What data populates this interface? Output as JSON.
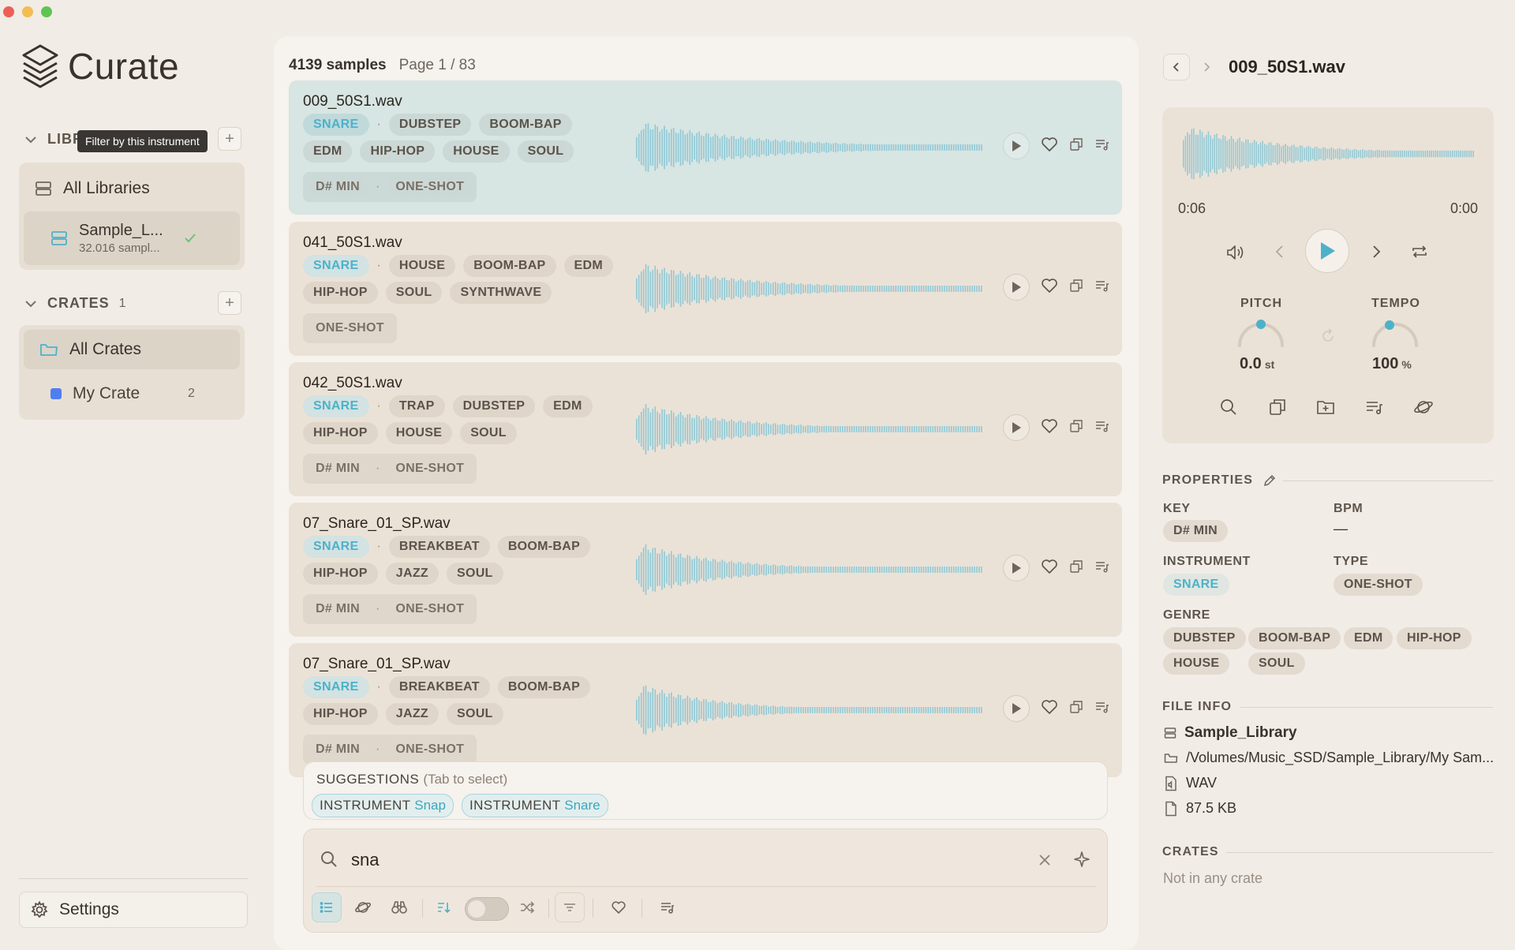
{
  "app": {
    "name": "Curate"
  },
  "tooltip": "Filter by this instrument",
  "sidebar": {
    "libraries_header": "LIBR",
    "libraries": [
      {
        "label": "All Libraries"
      },
      {
        "label": "Sample_L...",
        "sub": "32.016 sampl..."
      }
    ],
    "crates_header": "CRATES",
    "crates_count": "1",
    "crates": [
      {
        "label": "All Crates"
      },
      {
        "label": "My Crate",
        "count": "2",
        "color": "#4f7ef0"
      }
    ],
    "settings_label": "Settings"
  },
  "list": {
    "count": "4139 samples",
    "page": "Page 1 / 83",
    "items": [
      {
        "name": "009_50S1.wav",
        "instrument": "SNARE",
        "row1": [
          "DUBSTEP",
          "BOOM-BAP"
        ],
        "row2": [
          "EDM",
          "HIP-HOP",
          "HOUSE",
          "SOUL"
        ],
        "key": "D# MIN",
        "type": "ONE-SHOT"
      },
      {
        "name": "041_50S1.wav",
        "instrument": "SNARE",
        "row1": [
          "HOUSE",
          "BOOM-BAP",
          "EDM"
        ],
        "row2": [
          "HIP-HOP",
          "SOUL",
          "SYNTHWAVE"
        ],
        "key": "",
        "type": "ONE-SHOT"
      },
      {
        "name": "042_50S1.wav",
        "instrument": "SNARE",
        "row1": [
          "TRAP",
          "DUBSTEP",
          "EDM"
        ],
        "row2": [
          "HIP-HOP",
          "HOUSE",
          "SOUL"
        ],
        "key": "D# MIN",
        "type": "ONE-SHOT"
      },
      {
        "name": "07_Snare_01_SP.wav",
        "instrument": "SNARE",
        "row1": [
          "BREAKBEAT",
          "BOOM-BAP"
        ],
        "row2": [
          "HIP-HOP",
          "JAZZ",
          "SOUL"
        ],
        "key": "D# MIN",
        "type": "ONE-SHOT"
      },
      {
        "name": "07_Snare_01_SP.wav",
        "instrument": "SNARE",
        "row1": [
          "BREAKBEAT",
          "BOOM-BAP"
        ],
        "row2": [
          "HIP-HOP",
          "JAZZ",
          "SOUL"
        ],
        "key": "D# MIN",
        "type": "ONE-SHOT"
      }
    ]
  },
  "suggestions": {
    "title": "SUGGESTIONS",
    "hint": "(Tab to select)",
    "items": [
      {
        "field": "INSTRUMENT",
        "value": "Snap"
      },
      {
        "field": "INSTRUMENT",
        "value": "Snare"
      }
    ]
  },
  "search": {
    "value": "sna"
  },
  "detail": {
    "title": "009_50S1.wav",
    "time_elapsed": "0:06",
    "time_remaining": "0:00",
    "pitch_label": "PITCH",
    "pitch_value": "0.0",
    "pitch_unit": "st",
    "tempo_label": "TEMPO",
    "tempo_value": "100",
    "tempo_unit": "%",
    "properties_header": "PROPERTIES",
    "key_label": "KEY",
    "key_value": "D# MIN",
    "bpm_label": "BPM",
    "bpm_value": "—",
    "instrument_label": "INSTRUMENT",
    "instrument_value": "SNARE",
    "type_label": "TYPE",
    "type_value": "ONE-SHOT",
    "genre_label": "GENRE",
    "genres": [
      "DUBSTEP",
      "BOOM-BAP",
      "EDM",
      "HIP-HOP",
      "HOUSE",
      "SOUL"
    ],
    "file_info_header": "FILE INFO",
    "library": "Sample_Library",
    "path": "/Volumes/Music_SSD/Sample_Library/My Sam...",
    "format": "WAV",
    "size": "87.5 KB",
    "crates_header": "CRATES",
    "crates_value": "Not in any crate"
  },
  "colors": {
    "accent": "#4cb2c9",
    "background": "#f1ece6",
    "card": "#ebe2d7",
    "selected": "#d7e5e3"
  }
}
